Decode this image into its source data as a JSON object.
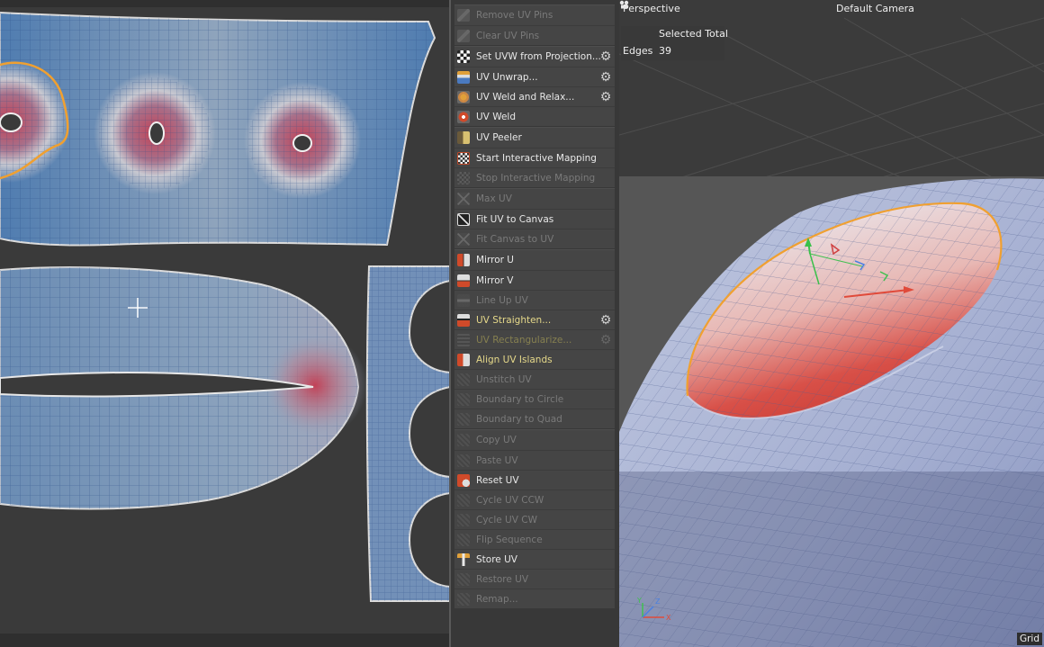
{
  "uv_editor": {
    "colors": {
      "island": "#6f8fb5",
      "island_dark": "#4e76a6",
      "seam": "#f0a030",
      "distortion": "#c04050",
      "border": "#dcdcdc"
    }
  },
  "uv_commands": {
    "groups": [
      {
        "items": [
          {
            "label": "Remove UV Pins",
            "icon": "pin-icon",
            "enabled": false
          },
          {
            "label": "Clear UV Pins",
            "icon": "pin-icon",
            "enabled": false
          }
        ]
      },
      {
        "items": [
          {
            "label": "Set UVW from Projection...",
            "icon": "projection-icon",
            "enabled": true,
            "settings": true
          },
          {
            "label": "UV Unwrap...",
            "icon": "unwrap-icon",
            "enabled": true,
            "settings": true
          },
          {
            "label": "UV Weld and Relax...",
            "icon": "weld-relax-icon",
            "enabled": true,
            "settings": true
          },
          {
            "label": "UV Weld",
            "icon": "weld-icon",
            "enabled": true
          }
        ]
      },
      {
        "items": [
          {
            "label": "UV Peeler",
            "icon": "peeler-icon",
            "enabled": true
          },
          {
            "label": "Start Interactive Mapping",
            "icon": "interactive-mapping-icon",
            "enabled": true
          },
          {
            "label": "Stop Interactive Mapping",
            "icon": "stop-mapping-icon",
            "enabled": false
          }
        ]
      },
      {
        "items": [
          {
            "label": "Max UV",
            "icon": "max-uv-icon",
            "enabled": false
          },
          {
            "label": "Fit UV to Canvas",
            "icon": "fit-uv-icon",
            "enabled": true
          },
          {
            "label": "Fit Canvas to UV",
            "icon": "fit-canvas-icon",
            "enabled": false
          }
        ]
      },
      {
        "items": [
          {
            "label": "Mirror U",
            "icon": "mirror-u-icon",
            "enabled": true
          },
          {
            "label": "Mirror V",
            "icon": "mirror-v-icon",
            "enabled": true
          },
          {
            "label": "Line Up UV",
            "icon": "line-up-icon",
            "enabled": false
          },
          {
            "label": "UV Straighten...",
            "icon": "straighten-icon",
            "enabled": true,
            "highlight": true,
            "settings": true
          },
          {
            "label": "UV Rectangularize...",
            "icon": "rectangularize-icon",
            "enabled": false,
            "highlight": true,
            "settings": true
          },
          {
            "label": "Align UV Islands",
            "icon": "align-islands-icon",
            "enabled": true,
            "highlight": true
          },
          {
            "label": "Unstitch UV",
            "icon": "unstitch-icon",
            "enabled": false
          },
          {
            "label": "Boundary to Circle",
            "icon": "boundary-circle-icon",
            "enabled": false
          },
          {
            "label": "Boundary to Quad",
            "icon": "boundary-quad-icon",
            "enabled": false
          }
        ]
      },
      {
        "items": [
          {
            "label": "Copy UV",
            "icon": "copy-uv-icon",
            "enabled": false
          },
          {
            "label": "Paste UV",
            "icon": "paste-uv-icon",
            "enabled": false
          },
          {
            "label": "Reset UV",
            "icon": "reset-uv-icon",
            "enabled": true
          },
          {
            "label": "Cycle UV CCW",
            "icon": "cycle-ccw-icon",
            "enabled": false
          },
          {
            "label": "Cycle UV CW",
            "icon": "cycle-cw-icon",
            "enabled": false
          },
          {
            "label": "Flip Sequence",
            "icon": "flip-sequence-icon",
            "enabled": false
          },
          {
            "label": "Store UV",
            "icon": "store-uv-icon",
            "enabled": true
          },
          {
            "label": "Restore UV",
            "icon": "restore-uv-icon",
            "enabled": false
          },
          {
            "label": "Remap...",
            "icon": "remap-icon",
            "enabled": false
          }
        ]
      }
    ]
  },
  "viewport": {
    "title": "Perspective",
    "camera": "Default Camera",
    "camera_icon": "camera-icon",
    "stats": {
      "header": "Selected Total",
      "label": "Edges",
      "value": "39"
    },
    "grid_label": "Grid",
    "axis": {
      "x": "X",
      "y": "Y",
      "z": "Z"
    }
  }
}
